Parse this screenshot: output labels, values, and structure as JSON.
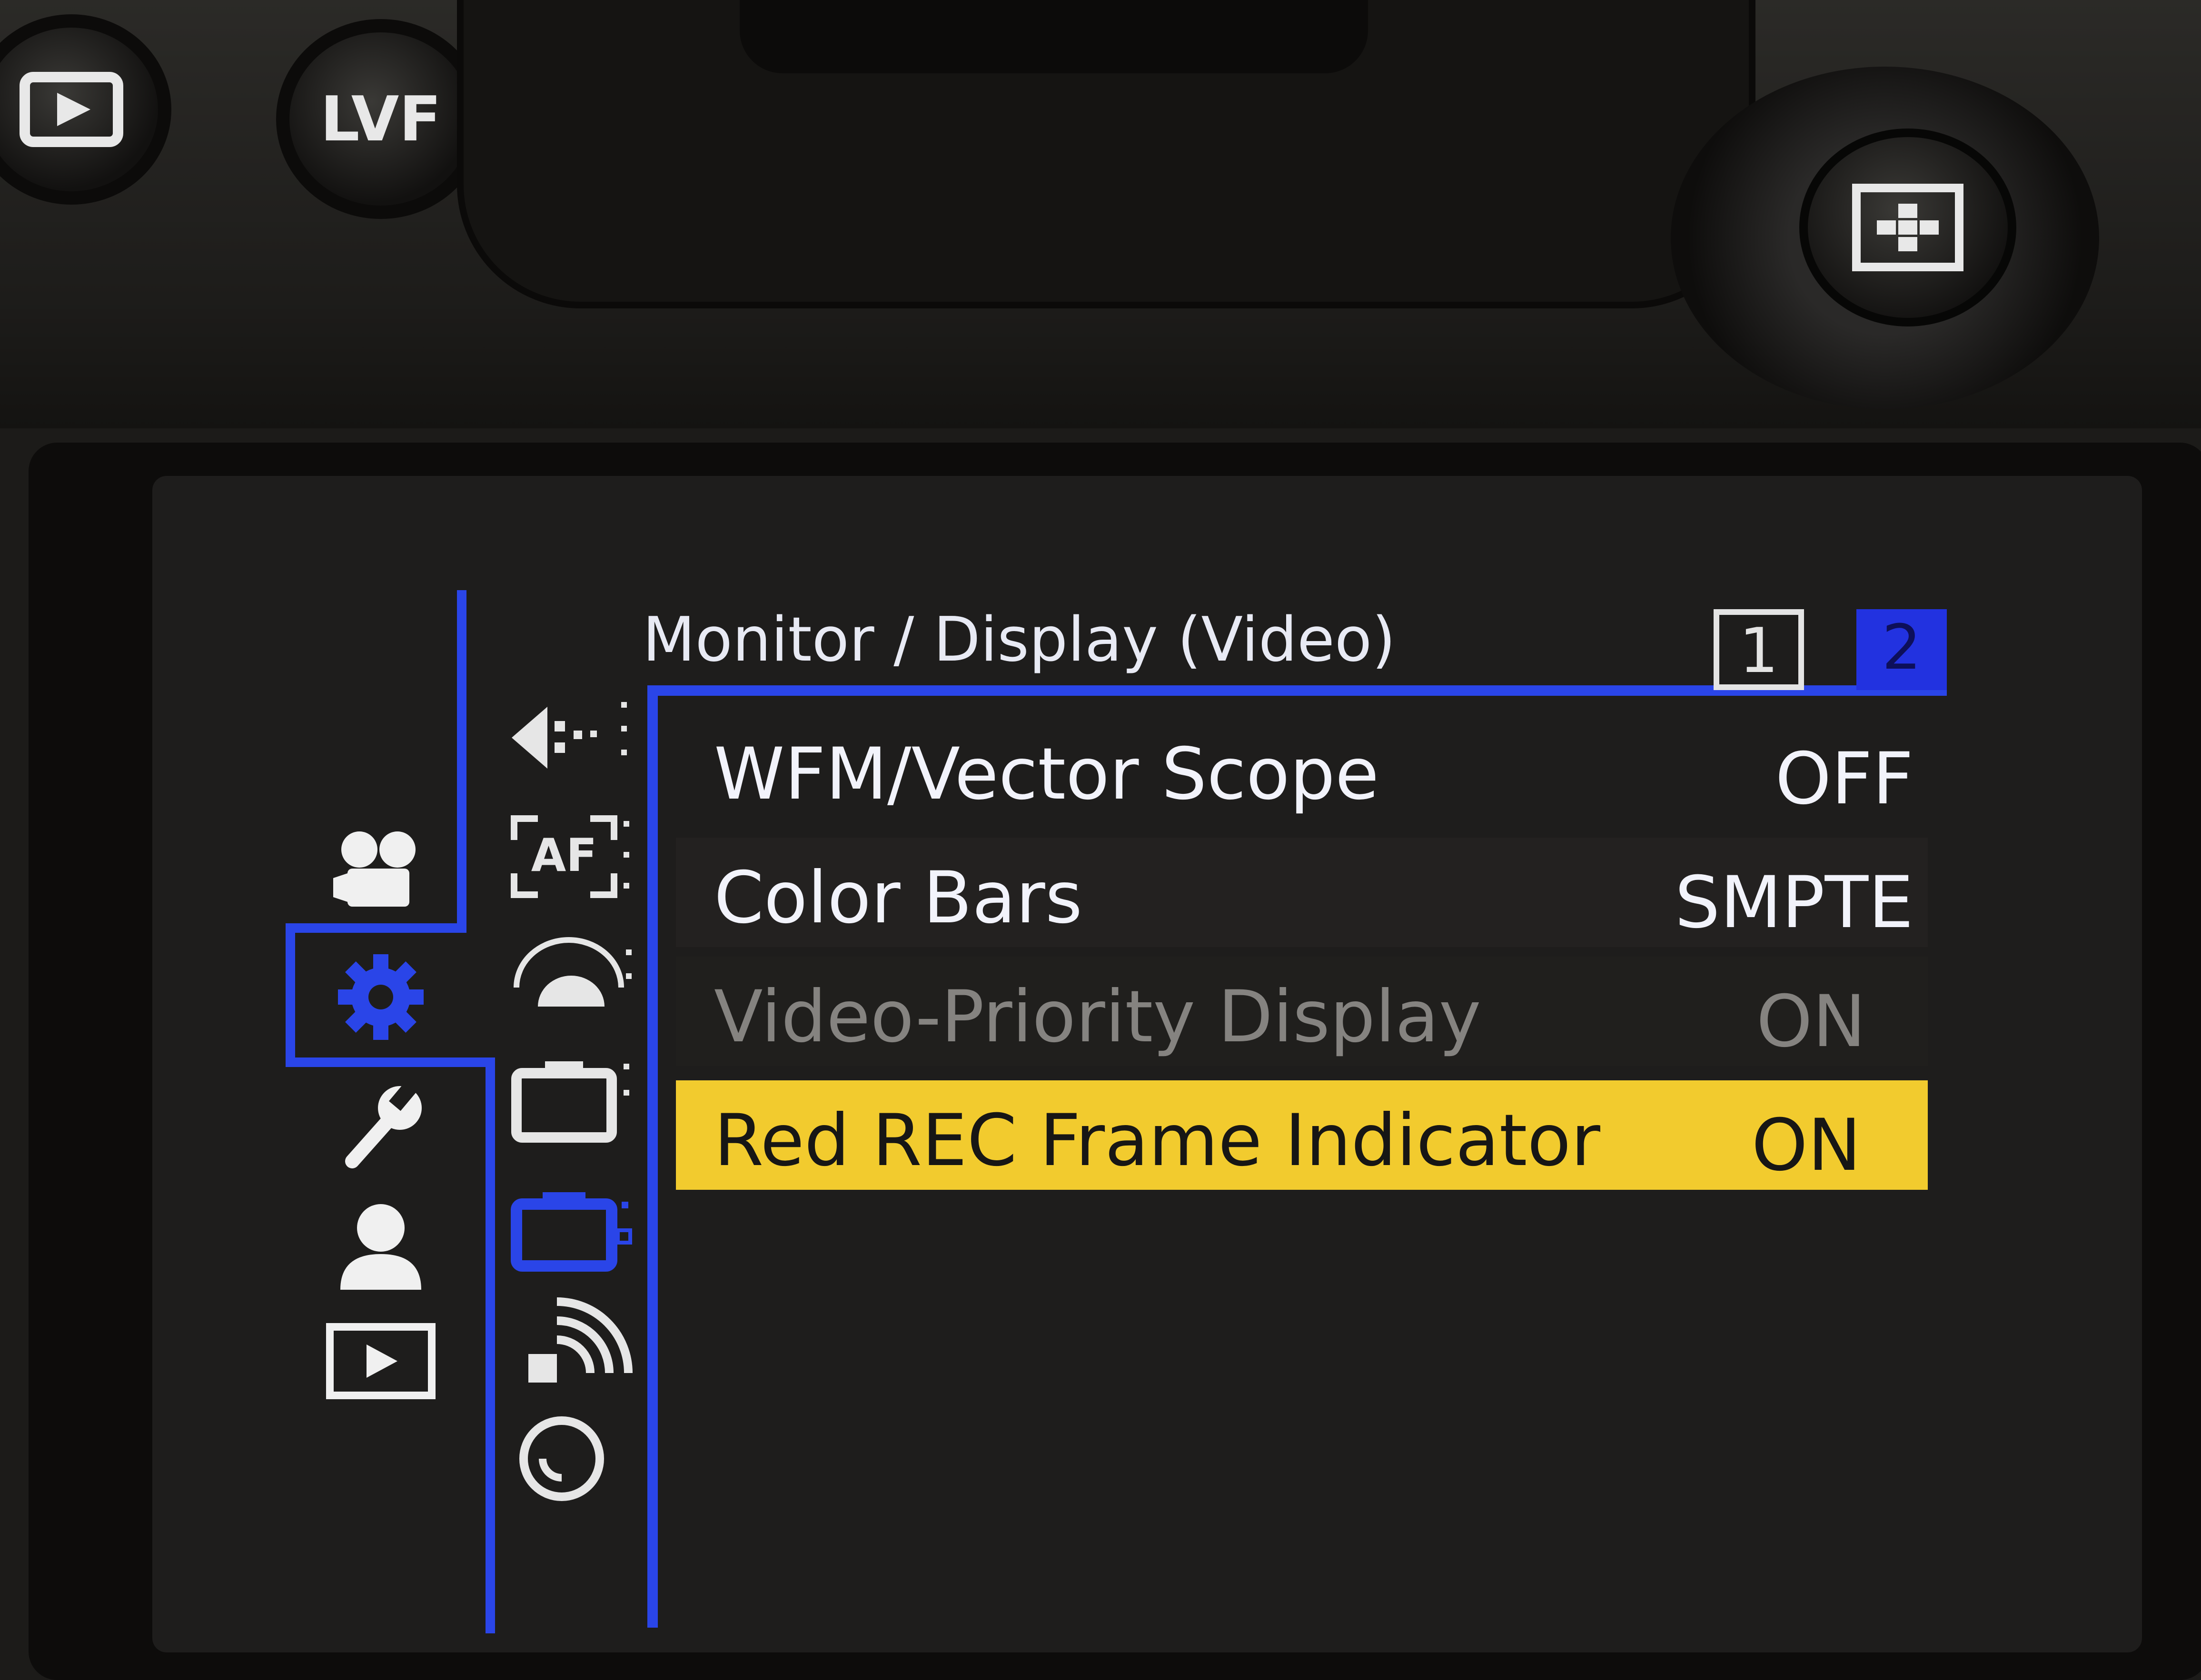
{
  "hardware": {
    "playback_button_icon": "play-icon",
    "lvf_button_label": "LVF",
    "joystick_icon": "grid-af-icon"
  },
  "menu": {
    "title": "Monitor / Display (Video)",
    "pages": [
      "1",
      "2"
    ],
    "active_page": "2",
    "main_tabs": [
      {
        "icon": "video-camera-icon",
        "selected": false
      },
      {
        "icon": "gear-icon",
        "selected": true
      },
      {
        "icon": "wrench-icon",
        "selected": false
      },
      {
        "icon": "person-icon",
        "selected": false
      },
      {
        "icon": "playback-icon",
        "selected": false
      }
    ],
    "sub_tabs": [
      {
        "icon": "image-quality-icon",
        "selected": false
      },
      {
        "icon": "af-icon",
        "selected": false
      },
      {
        "icon": "operation-dial-icon",
        "selected": false
      },
      {
        "icon": "monitor-display-photo-icon",
        "selected": false
      },
      {
        "icon": "monitor-display-video-icon",
        "selected": true
      },
      {
        "icon": "wireless-icon",
        "selected": false
      },
      {
        "icon": "lens-icon",
        "selected": false
      }
    ],
    "items": [
      {
        "label": "WFM/Vector Scope",
        "value": "OFF",
        "state": "normal"
      },
      {
        "label": "Color Bars",
        "value": "SMPTE",
        "state": "normal"
      },
      {
        "label": "Video-Priority Display",
        "value": "ON",
        "state": "disabled"
      },
      {
        "label": "Red REC Frame Indicator",
        "value": "ON",
        "state": "highlighted"
      }
    ],
    "colors": {
      "accent_blue": "#2a45e8",
      "highlight_yellow": "#f2cb2e",
      "text_white": "#f2f3fb",
      "text_disabled": "#858380"
    }
  }
}
